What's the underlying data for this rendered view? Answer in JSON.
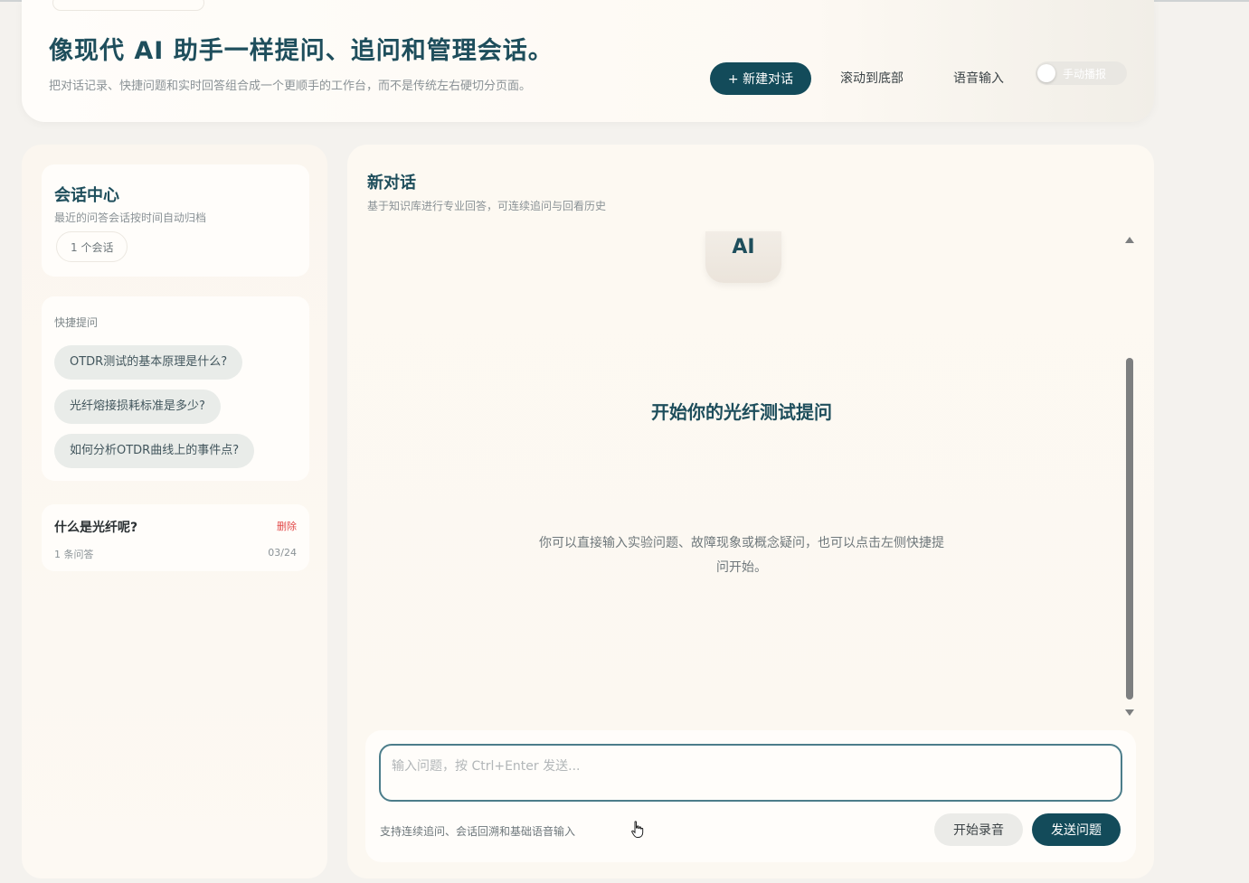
{
  "header": {
    "title": "像现代 AI 助手一样提问、追问和管理会话。",
    "subtitle": "把对话记录、快捷问题和实时回答组合成一个更顺手的工作台，而不是传统左右硬切分页面。",
    "new_chat_label": "+ 新建对话",
    "scroll_bottom_label": "滚动到底部",
    "voice_input_label": "语音输入",
    "auto_play_label": "手动播报"
  },
  "sidebar": {
    "center_title": "会话中心",
    "center_desc": "最近的问答会话按时间自动归档",
    "session_count": "1 个会话",
    "quick_title": "快捷提问",
    "quick_questions": [
      "OTDR测试的基本原理是什么?",
      "光纤熔接损耗标准是多少?",
      "如何分析OTDR曲线上的事件点?"
    ],
    "sessions": [
      {
        "title": "什么是光纤呢?",
        "delete_label": "删除",
        "meta": "1 条问答",
        "date": "03/24"
      }
    ]
  },
  "chat": {
    "title": "新对话",
    "desc": "基于知识库进行专业回答，可连续追问与回看历史",
    "ai_badge": "AI",
    "empty_title": "开始你的光纤测试提问",
    "empty_desc": "你可以直接输入实验问题、故障现象或概念疑问，也可以点击左侧快捷提问开始。",
    "input_placeholder": "输入问题，按 Ctrl+Enter 发送...",
    "input_hint": "支持连续追问、会话回溯和基础语音输入",
    "record_label": "开始录音",
    "send_label": "发送问题"
  },
  "colors": {
    "accent": "#134b5a",
    "title": "#1e4e5c",
    "danger": "#e24a4a"
  }
}
